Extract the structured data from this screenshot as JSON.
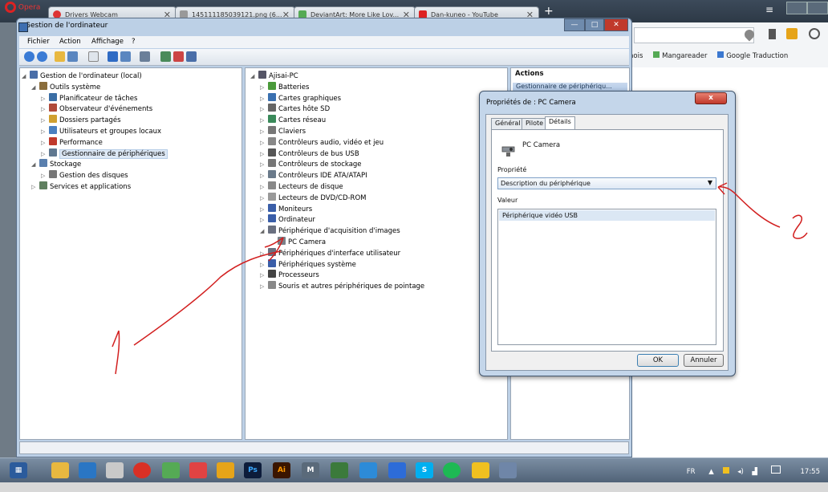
{
  "browser": {
    "logo_label": "Opera",
    "tabs": [
      {
        "label": "Drivers Webcam",
        "color": "#d33"
      },
      {
        "label": "145111185039121.png (6...",
        "color": "#999"
      },
      {
        "label": "DeviantArt: More Like Lov...",
        "color": "#5a5"
      },
      {
        "label": "Dan-kuneo - YouTube",
        "color": "#d22"
      }
    ],
    "new_tab": "+",
    "bookmarks": [
      "nois",
      "Mangareader",
      "Google Traduction"
    ]
  },
  "mmc": {
    "title": "Gestion de l'ordinateur",
    "menu": [
      "Fichier",
      "Action",
      "Affichage",
      "?"
    ],
    "tree": [
      {
        "label": "Gestion de l'ordinateur (local)",
        "level": 0,
        "color": "#4a6ea8"
      },
      {
        "label": "Outils système",
        "level": 1,
        "color": "#8a6d3b"
      },
      {
        "label": "Planificateur de tâches",
        "level": 2,
        "color": "#3b6ea5"
      },
      {
        "label": "Observateur d'événements",
        "level": 2,
        "color": "#b04a3a"
      },
      {
        "label": "Dossiers partagés",
        "level": 2,
        "color": "#d0a030"
      },
      {
        "label": "Utilisateurs et groupes locaux",
        "level": 2,
        "color": "#4a80c0"
      },
      {
        "label": "Performance",
        "level": 2,
        "color": "#c0392b"
      },
      {
        "label": "Gestionnaire de périphériques",
        "level": 2,
        "color": "#607890",
        "selected": true
      },
      {
        "label": "Stockage",
        "level": 1,
        "color": "#5a7fae"
      },
      {
        "label": "Gestion des disques",
        "level": 2,
        "color": "#777"
      },
      {
        "label": "Services et applications",
        "level": 1,
        "color": "#5f7f5f"
      }
    ],
    "devices": [
      {
        "label": "Ajisai-PC",
        "level": 0,
        "color": "#556"
      },
      {
        "label": "Batteries",
        "level": 1,
        "color": "#4a9a3a"
      },
      {
        "label": "Cartes graphiques",
        "level": 1,
        "color": "#3a70b0"
      },
      {
        "label": "Cartes hôte SD",
        "level": 1,
        "color": "#666"
      },
      {
        "label": "Cartes réseau",
        "level": 1,
        "color": "#3a8a5a"
      },
      {
        "label": "Claviers",
        "level": 1,
        "color": "#777"
      },
      {
        "label": "Contrôleurs audio, vidéo et jeu",
        "level": 1,
        "color": "#888"
      },
      {
        "label": "Contrôleurs de bus USB",
        "level": 1,
        "color": "#555"
      },
      {
        "label": "Contrôleurs de stockage",
        "level": 1,
        "color": "#777"
      },
      {
        "label": "Contrôleurs IDE ATA/ATAPI",
        "level": 1,
        "color": "#6a7a8a"
      },
      {
        "label": "Lecteurs de disque",
        "level": 1,
        "color": "#888"
      },
      {
        "label": "Lecteurs de DVD/CD-ROM",
        "level": 1,
        "color": "#999"
      },
      {
        "label": "Moniteurs",
        "level": 1,
        "color": "#3a5ea8"
      },
      {
        "label": "Ordinateur",
        "level": 1,
        "color": "#3a5ea8"
      },
      {
        "label": "Périphérique d'acquisition d'images",
        "level": 1,
        "color": "#6a7080",
        "expanded": true
      },
      {
        "label": "PC Camera",
        "level": 2,
        "color": "#7a8088"
      },
      {
        "label": "Périphériques d'interface utilisateur",
        "level": 1,
        "color": "#6a7080"
      },
      {
        "label": "Périphériques système",
        "level": 1,
        "color": "#3a5ea8"
      },
      {
        "label": "Processeurs",
        "level": 1,
        "color": "#444"
      },
      {
        "label": "Souris et autres périphériques de pointage",
        "level": 1,
        "color": "#888"
      }
    ],
    "actions_title": "Actions",
    "actions_item": "Gestionnaire de périphériqu..."
  },
  "dialog": {
    "title": "Propriétés de : PC Camera",
    "close": "x",
    "tabs": [
      "Général",
      "Pilote",
      "Détails"
    ],
    "device_name": "PC Camera",
    "property_label": "Propriété",
    "property_value": "Description du périphérique",
    "value_label": "Valeur",
    "value_item": "Périphérique vidéo USB",
    "ok": "OK",
    "cancel": "Annuler"
  },
  "annotations": {
    "number_one": "1",
    "number_two": "2"
  },
  "taskbar": {
    "lang": "FR",
    "time": "17:55"
  }
}
